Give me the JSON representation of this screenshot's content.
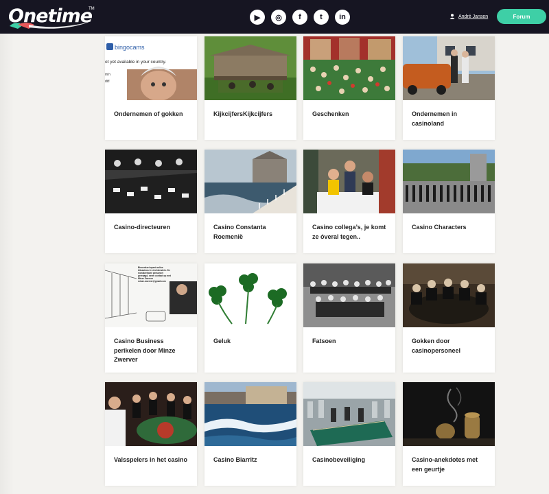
{
  "header": {
    "logo_text": "Onetime",
    "logo_tm": "TM",
    "socials": [
      {
        "icon": "youtube-icon",
        "glyph": "▶"
      },
      {
        "icon": "instagram-icon",
        "glyph": "◎"
      },
      {
        "icon": "facebook-icon",
        "glyph": "f"
      },
      {
        "icon": "twitter-icon",
        "glyph": "t"
      },
      {
        "icon": "linkedin-icon",
        "glyph": "in"
      }
    ],
    "user_name": "André Jansen",
    "forum_label": "Forum"
  },
  "image_texts": {
    "bingocams": "bingocams",
    "not_available": "ot yet available in your country.",
    "fragment_1": "m'n",
    "fragment_2": "dit!",
    "business_text": "Binnenkort opent online bitcasinos in Liechtenstein. De monikeerbare personeel gevraagd, neem contact op met Minze Zwerver minze.zwerver@gmail.com"
  },
  "cards": [
    {
      "title": "Ondernemen of gokken"
    },
    {
      "title": "KijkcijfersKijkcijfers"
    },
    {
      "title": "Geschenken"
    },
    {
      "title": "Ondernemen in casinoland"
    },
    {
      "title": "Casino-directeuren"
    },
    {
      "title": "Casino Constanta Roemenië"
    },
    {
      "title": "Casino collega’s, je komt ze óveral tegen.."
    },
    {
      "title": "Casino Characters"
    },
    {
      "title": "Casino Business perikelen door Minze Zwerver"
    },
    {
      "title": "Geluk"
    },
    {
      "title": "Fatsoen"
    },
    {
      "title": "Gokken door casinopersoneel"
    },
    {
      "title": "Valsspelers in het casino"
    },
    {
      "title": "Casino Biarritz"
    },
    {
      "title": "Casinobeveiliging"
    },
    {
      "title": "Casino-anekdotes met een geurtje"
    }
  ],
  "colors": {
    "header_bg": "#161522",
    "accent": "#3ecfa6",
    "page_bg": "#f3f2ef"
  }
}
